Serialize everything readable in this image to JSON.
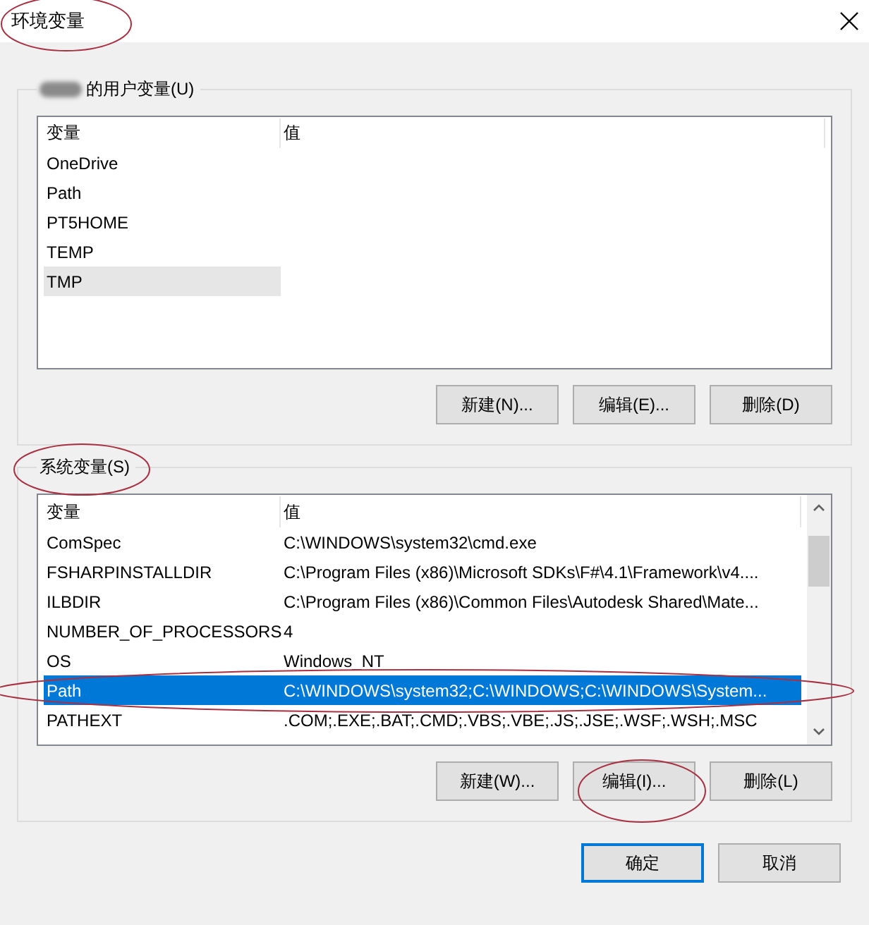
{
  "window": {
    "title": "环境变量"
  },
  "user_variables": {
    "label": "的用户变量(U)",
    "focused": false,
    "columns": [
      "变量",
      "值"
    ],
    "rows": [
      {
        "name": "OneDrive",
        "value": "",
        "selected": false
      },
      {
        "name": "Path",
        "value": "",
        "selected": false
      },
      {
        "name": "PT5HOME",
        "value": "",
        "selected": false
      },
      {
        "name": "TEMP",
        "value": "",
        "selected": false
      },
      {
        "name": "TMP",
        "value": "",
        "selected": true
      }
    ],
    "buttons": [
      "新建(N)...",
      "编辑(E)...",
      "删除(D)"
    ]
  },
  "system_variables": {
    "label": "系统变量(S)",
    "focused": true,
    "columns": [
      "变量",
      "值"
    ],
    "rows": [
      {
        "name": "ComSpec",
        "value": "C:\\WINDOWS\\system32\\cmd.exe",
        "selected": false
      },
      {
        "name": "FSHARPINSTALLDIR",
        "value": "C:\\Program Files (x86)\\Microsoft SDKs\\F#\\4.1\\Framework\\v4....",
        "selected": false
      },
      {
        "name": "ILBDIR",
        "value": "C:\\Program Files (x86)\\Common Files\\Autodesk Shared\\Mate...",
        "selected": false
      },
      {
        "name": "NUMBER_OF_PROCESSORS",
        "value": "4",
        "selected": false
      },
      {
        "name": "OS",
        "value": "Windows_NT",
        "selected": false
      },
      {
        "name": "Path",
        "value": "C:\\WINDOWS\\system32;C:\\WINDOWS;C:\\WINDOWS\\System...",
        "selected": true
      },
      {
        "name": "PATHEXT",
        "value": ".COM;.EXE;.BAT;.CMD;.VBS;.VBE;.JS;.JSE;.WSF;.WSH;.MSC",
        "selected": false
      }
    ],
    "buttons": [
      "新建(W)...",
      "编辑(I)...",
      "删除(L)"
    ]
  },
  "dialog_buttons": [
    {
      "label": "确定",
      "default": true
    },
    {
      "label": "取消",
      "default": false
    }
  ]
}
